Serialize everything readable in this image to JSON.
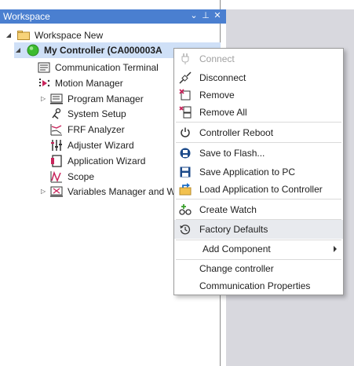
{
  "panel": {
    "title": "Workspace",
    "controls": [
      "⌄",
      "⊥",
      "✕"
    ]
  },
  "tree": {
    "root_label": "Workspace New",
    "controller_label": "My Controller (CA000003A",
    "items": [
      {
        "label": "Communication Terminal"
      },
      {
        "label": "Motion Manager"
      },
      {
        "label": "Program Manager"
      },
      {
        "label": "System Setup"
      },
      {
        "label": "FRF Analyzer"
      },
      {
        "label": "Adjuster Wizard"
      },
      {
        "label": "Application Wizard"
      },
      {
        "label": "Scope"
      },
      {
        "label": "Variables Manager and Wa"
      }
    ]
  },
  "context_menu": {
    "items": [
      {
        "label": "Connect",
        "icon": "connect-plug-icon",
        "disabled": true
      },
      {
        "label": "Disconnect",
        "icon": "disconnect-plug-icon"
      },
      {
        "label": "Remove",
        "icon": "remove-icon"
      },
      {
        "label": "Remove All",
        "icon": "remove-all-icon"
      },
      {
        "label": "Controller Reboot",
        "icon": "power-icon"
      },
      {
        "label": "Save to Flash...",
        "icon": "save-flash-icon"
      },
      {
        "label": "Save Application to PC",
        "icon": "save-pc-icon"
      },
      {
        "label": "Load Application to Controller",
        "icon": "load-app-icon"
      },
      {
        "label": "Create Watch",
        "icon": "create-watch-icon"
      },
      {
        "label": "Factory Defaults",
        "icon": "history-icon"
      },
      {
        "label": "Add Component",
        "has_submenu": true
      },
      {
        "label": "Change controller"
      },
      {
        "label": "Communication Properties"
      }
    ]
  },
  "colors": {
    "titlebar": "#4a7fd0",
    "selection": "#cfe0f7",
    "status_green": "#3dbb2f",
    "gray_area": "#d8d8de"
  }
}
